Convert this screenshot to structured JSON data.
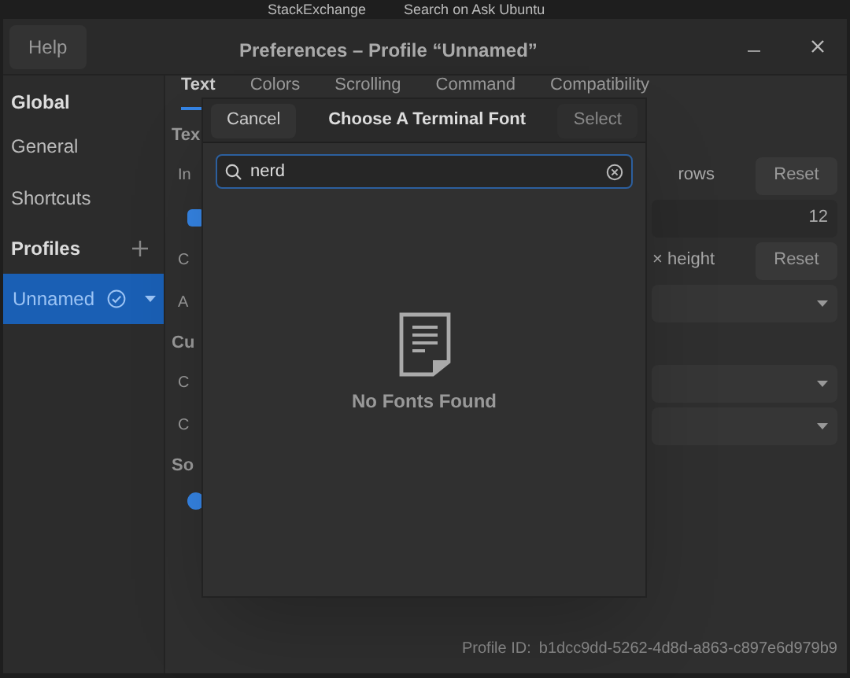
{
  "desktop": {
    "items": [
      "StackExchange",
      "Search on Ask Ubuntu"
    ]
  },
  "window": {
    "title": "Preferences – Profile “Unnamed”",
    "help": "Help"
  },
  "sidebar": {
    "global": "Global",
    "items": [
      {
        "label": "General",
        "selected": false
      },
      {
        "label": "Shortcuts",
        "selected": false
      }
    ],
    "profiles": "Profiles",
    "profile_items": [
      {
        "label": "Unnamed",
        "selected": true,
        "default": true
      }
    ]
  },
  "tabs": [
    {
      "label": "Text",
      "selected": true
    },
    {
      "label": "Colors",
      "selected": false
    },
    {
      "label": "Scrolling",
      "selected": false
    },
    {
      "label": "Command",
      "selected": false
    },
    {
      "label": "Compatibility",
      "selected": false
    }
  ],
  "settings": [
    {
      "kind": "heading",
      "label": "Tex"
    },
    {
      "kind": "spin",
      "label": "In",
      "unit": "rows",
      "button": "Reset"
    },
    {
      "kind": "check",
      "checked": true,
      "value": "12"
    },
    {
      "kind": "spin",
      "label": "C",
      "unit": "× height",
      "button": "Reset"
    },
    {
      "kind": "dropdown",
      "label": "A"
    },
    {
      "kind": "heading",
      "label": "Cu"
    },
    {
      "kind": "dropdown",
      "label": "C"
    },
    {
      "kind": "dropdown",
      "label": "C"
    },
    {
      "kind": "heading",
      "label": "So"
    },
    {
      "kind": "radio",
      "selected": true
    }
  ],
  "footer": {
    "profile_id_label": "Profile ID:",
    "profile_id": "b1dcc9dd-5262-4d8d-a863-c897e6d979b9"
  },
  "dialog": {
    "cancel": "Cancel",
    "title": "Choose A Terminal Font",
    "select": "Select",
    "search": {
      "value": "nerd"
    },
    "empty_message": "No Fonts Found"
  }
}
